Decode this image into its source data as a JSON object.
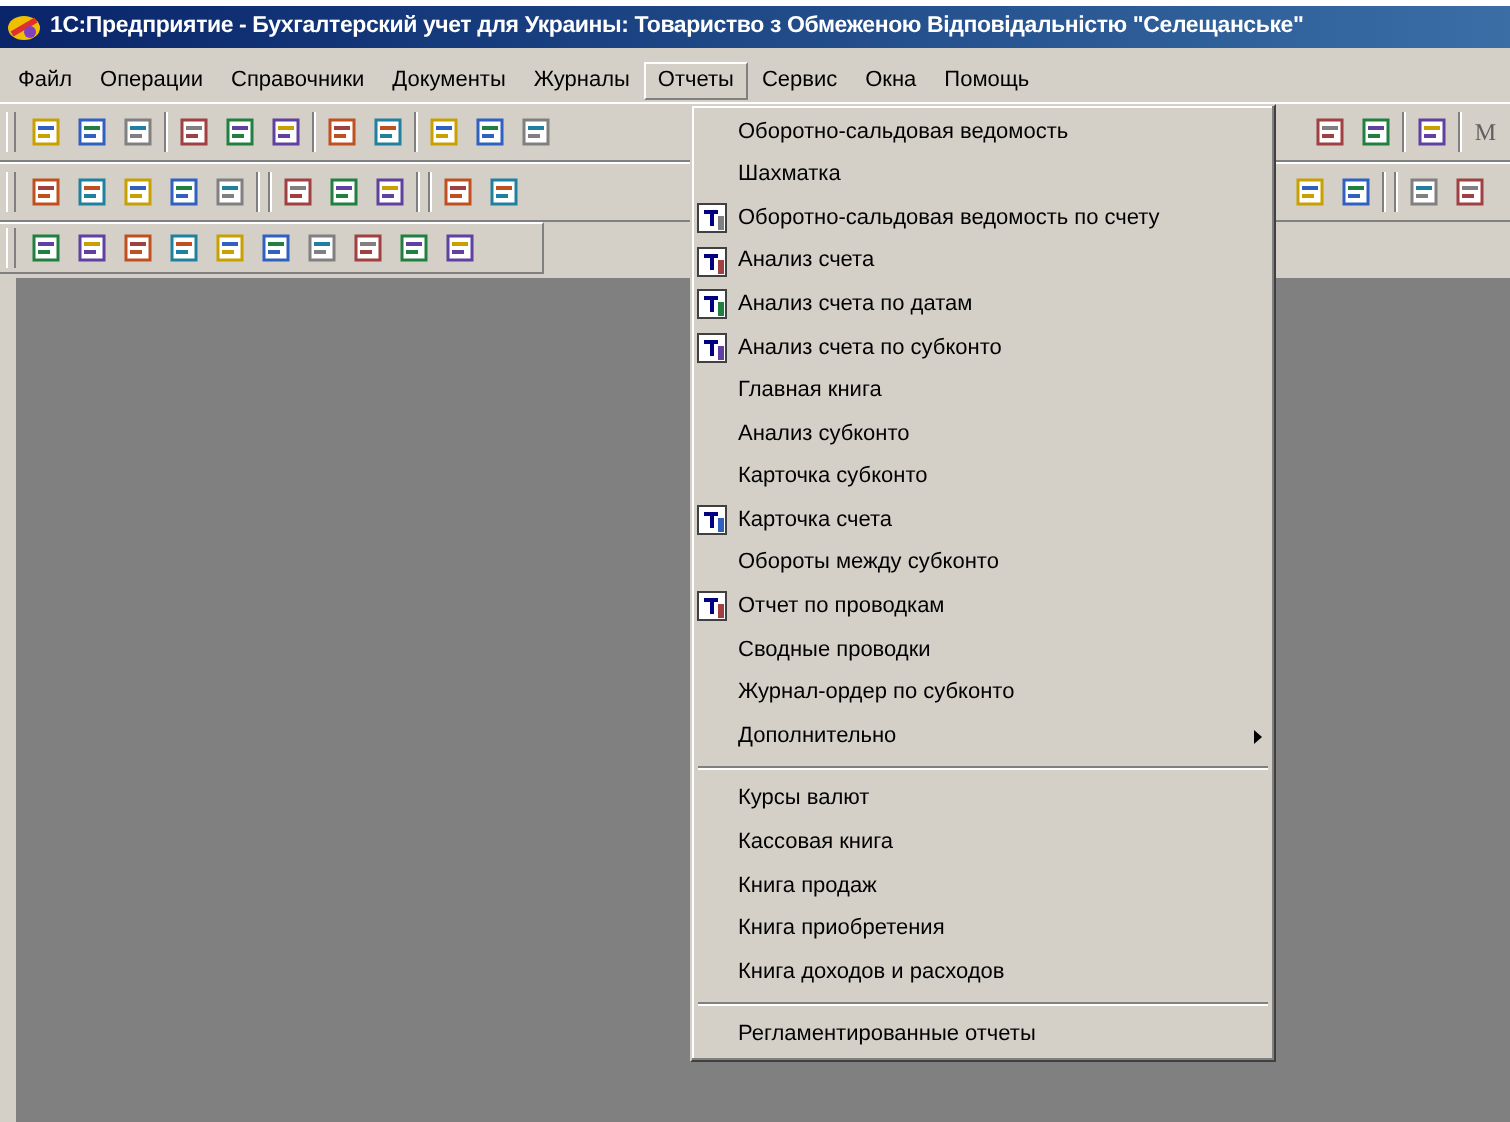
{
  "window": {
    "title": "1С:Предприятие - Бухгалтерский учет для Украины: Товариство з Обмеженою Відповідальністю \"Селещанське\""
  },
  "menu_bar": [
    {
      "label": "Файл",
      "selected": false
    },
    {
      "label": "Операции",
      "selected": false
    },
    {
      "label": "Справочники",
      "selected": false
    },
    {
      "label": "Документы",
      "selected": false
    },
    {
      "label": "Журналы",
      "selected": false
    },
    {
      "label": "Отчеты",
      "selected": true
    },
    {
      "label": "Сервис",
      "selected": false
    },
    {
      "label": "Окна",
      "selected": false
    },
    {
      "label": "Помощь",
      "selected": false
    }
  ],
  "toolbar": {
    "text_button": "M"
  },
  "dropdown": [
    {
      "kind": "item",
      "label": "Оборотно-сальдовая ведомость"
    },
    {
      "kind": "item",
      "label": "Шахматка"
    },
    {
      "kind": "icon_item",
      "label": "Оборотно-сальдовая ведомость по счету"
    },
    {
      "kind": "icon_item",
      "label": "Анализ счета"
    },
    {
      "kind": "icon_item",
      "label": "Анализ счета по датам"
    },
    {
      "kind": "icon_item",
      "label": "Анализ счета по субконто"
    },
    {
      "kind": "item",
      "label": "Главная книга"
    },
    {
      "kind": "item",
      "label": "Анализ субконто"
    },
    {
      "kind": "item",
      "label": "Карточка субконто"
    },
    {
      "kind": "icon_item",
      "label": "Карточка счета"
    },
    {
      "kind": "item",
      "label": "Обороты между субконто"
    },
    {
      "kind": "icon_item",
      "label": "Отчет по проводкам"
    },
    {
      "kind": "item",
      "label": "Сводные проводки"
    },
    {
      "kind": "item",
      "label": "Журнал-ордер по субконто"
    },
    {
      "kind": "submenu",
      "label": "Дополнительно"
    },
    {
      "kind": "separator"
    },
    {
      "kind": "item",
      "label": "Курсы валют"
    },
    {
      "kind": "item",
      "label": "Кассовая книга"
    },
    {
      "kind": "item",
      "label": "Книга продаж"
    },
    {
      "kind": "item",
      "label": "Книга приобретения"
    },
    {
      "kind": "item",
      "label": "Книга доходов и расходов"
    },
    {
      "kind": "separator"
    },
    {
      "kind": "item",
      "label": "Регламентированные отчеты"
    }
  ]
}
